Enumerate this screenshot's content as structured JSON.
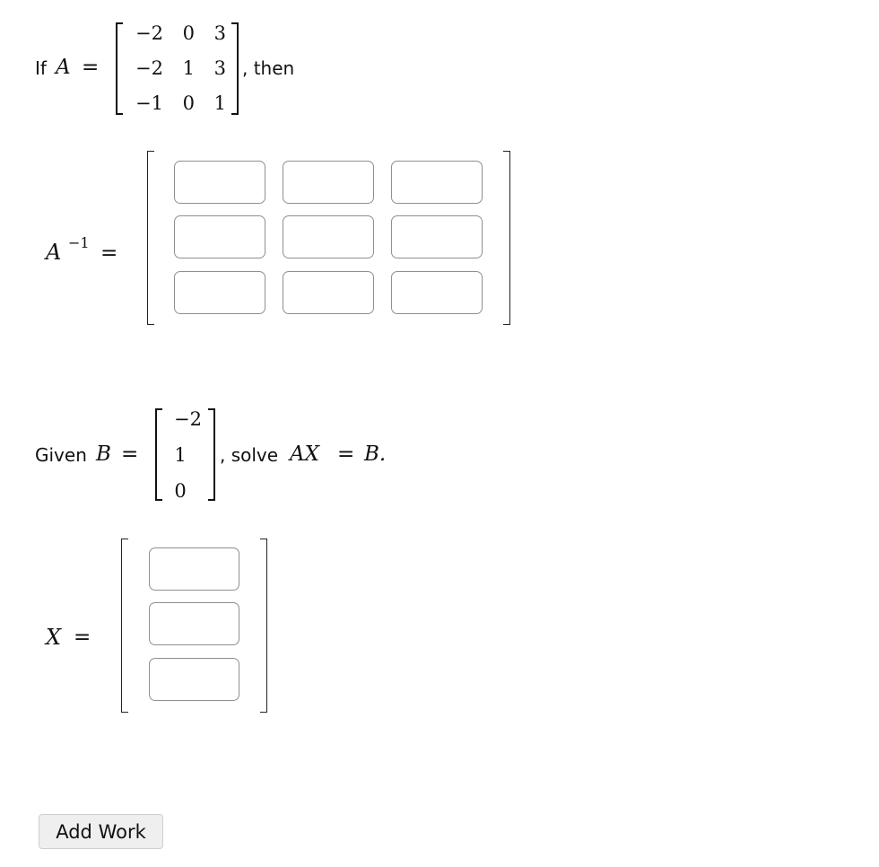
{
  "problem": {
    "intro_prefix": "If",
    "matrix_A_symbol": "A",
    "equals": "=",
    "intro_suffix": ", then",
    "matrix_A": [
      [
        "−2",
        "0",
        "3"
      ],
      [
        "−2",
        "1",
        "3"
      ],
      [
        "−1",
        "0",
        "1"
      ]
    ],
    "inverse_label_base": "A",
    "inverse_label_exp": "−1",
    "inverse_inputs": [
      [
        "",
        "",
        ""
      ],
      [
        "",
        "",
        ""
      ],
      [
        "",
        "",
        ""
      ]
    ],
    "given_prefix": "Given",
    "matrix_B_symbol": "B",
    "matrix_B": [
      "−2",
      "1",
      "0"
    ],
    "solve_text": ", solve",
    "equation_lhs": "AX",
    "equation_rhs": "B.",
    "x_label": "X",
    "x_inputs": [
      "",
      "",
      ""
    ]
  },
  "actions": {
    "add_work_label": "Add Work"
  }
}
